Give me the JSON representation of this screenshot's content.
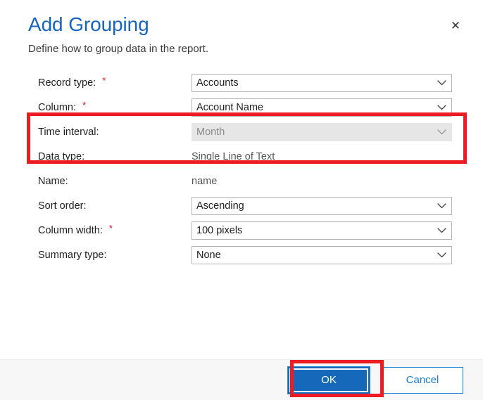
{
  "dialog": {
    "title": "Add Grouping",
    "subtitle": "Define how to group data in the report.",
    "close_icon": "close-icon",
    "close_glyph": "✕"
  },
  "colors": {
    "title_blue": "#1565c0",
    "primary_button": "#1568ba",
    "link_blue": "#1a7fd4",
    "annotation_red": "#ec1c24",
    "required_star": "#e81123",
    "disabled_bg": "#e6e6e6",
    "footer_bg": "#f7f7f7"
  },
  "form": {
    "required_marker": "*",
    "rows": [
      {
        "label": "Record type:",
        "required": true,
        "control": "combo",
        "value": "Accounts",
        "disabled": false,
        "name": "record-type"
      },
      {
        "label": "Column:",
        "required": true,
        "control": "combo",
        "value": "Account Name",
        "disabled": false,
        "name": "column"
      },
      {
        "label": "Time interval:",
        "required": false,
        "control": "combo",
        "value": "Month",
        "disabled": true,
        "name": "time-interval"
      },
      {
        "label": "Data type:",
        "required": false,
        "control": "static",
        "value": "Single Line of Text",
        "disabled": false,
        "name": "data-type"
      },
      {
        "label": "Name:",
        "required": false,
        "control": "static",
        "value": "name",
        "disabled": false,
        "name": "name"
      },
      {
        "label": "Sort order:",
        "required": false,
        "control": "combo",
        "value": "Ascending",
        "disabled": false,
        "name": "sort-order"
      },
      {
        "label": "Column width:",
        "required": true,
        "control": "combo",
        "value": "100 pixels",
        "disabled": false,
        "name": "column-width"
      },
      {
        "label": "Summary type:",
        "required": false,
        "control": "combo",
        "value": "None",
        "disabled": false,
        "name": "summary-type"
      }
    ]
  },
  "footer": {
    "ok_label": "OK",
    "cancel_label": "Cancel"
  },
  "annotations": [
    {
      "name": "annotation-required-fields",
      "target": "record-type-and-column-rows"
    },
    {
      "name": "annotation-ok-button",
      "target": "ok-button"
    }
  ]
}
